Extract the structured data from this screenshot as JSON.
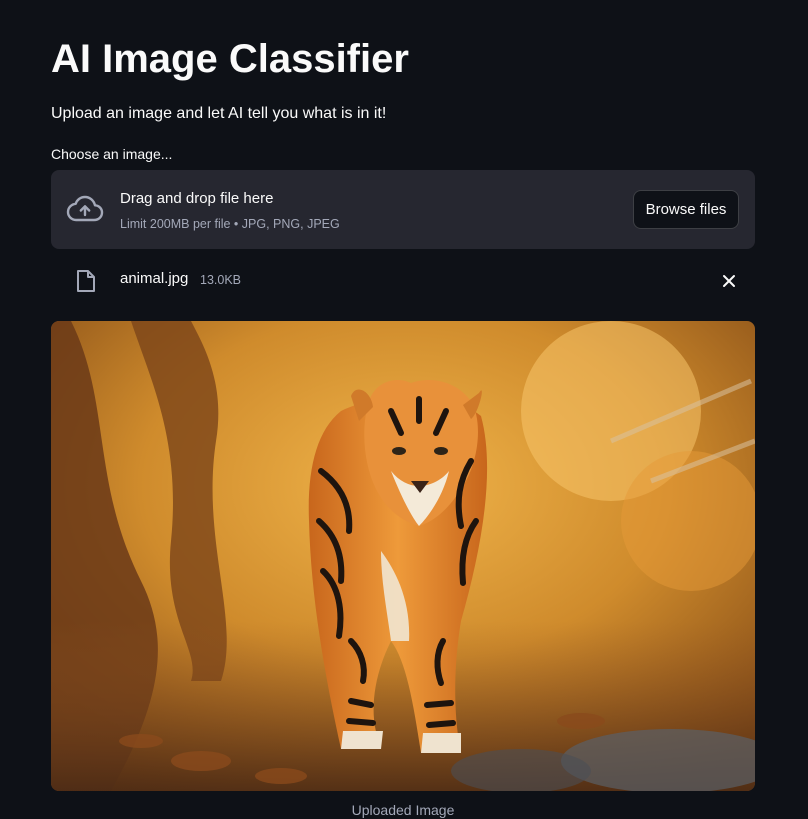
{
  "header": {
    "title": "AI Image Classifier",
    "subtitle": "Upload an image and let AI tell you what is in it!"
  },
  "uploader": {
    "label": "Choose an image...",
    "drop_text": "Drag and drop file here",
    "limit_text": "Limit 200MB per file • JPG, PNG, JPEG",
    "browse_label": "Browse files",
    "cloud_icon": "cloud-upload-icon"
  },
  "uploaded_file": {
    "name": "animal.jpg",
    "size": "13.0KB",
    "file_icon": "file-icon",
    "remove_icon": "close-icon"
  },
  "image": {
    "subject": "tiger",
    "caption": "Uploaded Image"
  },
  "colors": {
    "background": "#0e1117",
    "panel": "#262730",
    "text": "#fafafa",
    "muted": "#a3a8b8"
  }
}
